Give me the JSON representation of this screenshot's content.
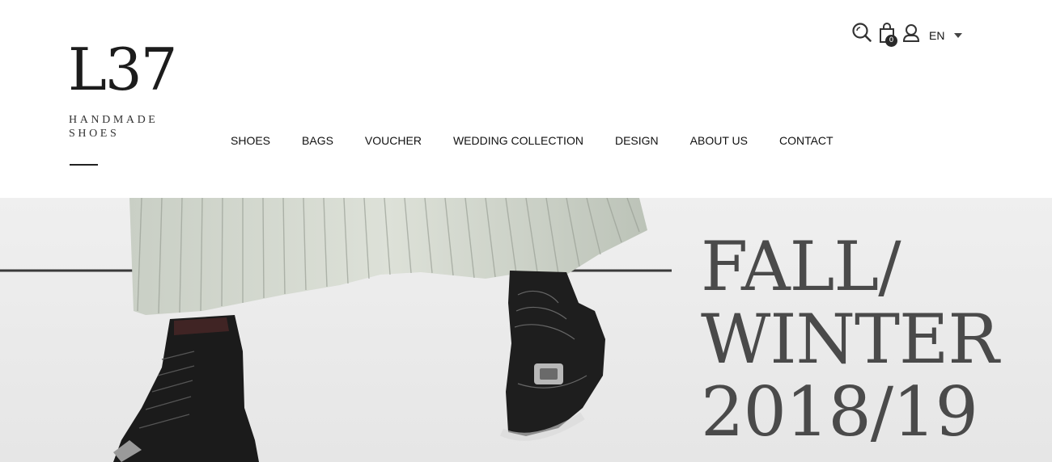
{
  "brand": {
    "logo_mark": "L37",
    "tagline_line1": "HANDMADE",
    "tagline_line2": "SHOES"
  },
  "nav": {
    "items": [
      {
        "label": "SHOES"
      },
      {
        "label": "BAGS"
      },
      {
        "label": "VOUCHER"
      },
      {
        "label": "WEDDING COLLECTION"
      },
      {
        "label": "DESIGN"
      },
      {
        "label": "ABOUT US"
      },
      {
        "label": "CONTACT"
      }
    ]
  },
  "utility": {
    "search_icon": "search-icon",
    "bag_icon": "shopping-bag-icon",
    "user_icon": "user-icon",
    "cart_count": "0",
    "language": "EN"
  },
  "hero": {
    "headline_line1": "FALL/",
    "headline_line2": "WINTER",
    "headline_line3": "2018/19",
    "image_subject": "pleated-skirt-and-black-lace-up-boots"
  },
  "colors": {
    "hero_background": "#efefef",
    "headline": "#4a4a4a",
    "text": "#111111",
    "accent_line": "#3a3a3a"
  }
}
